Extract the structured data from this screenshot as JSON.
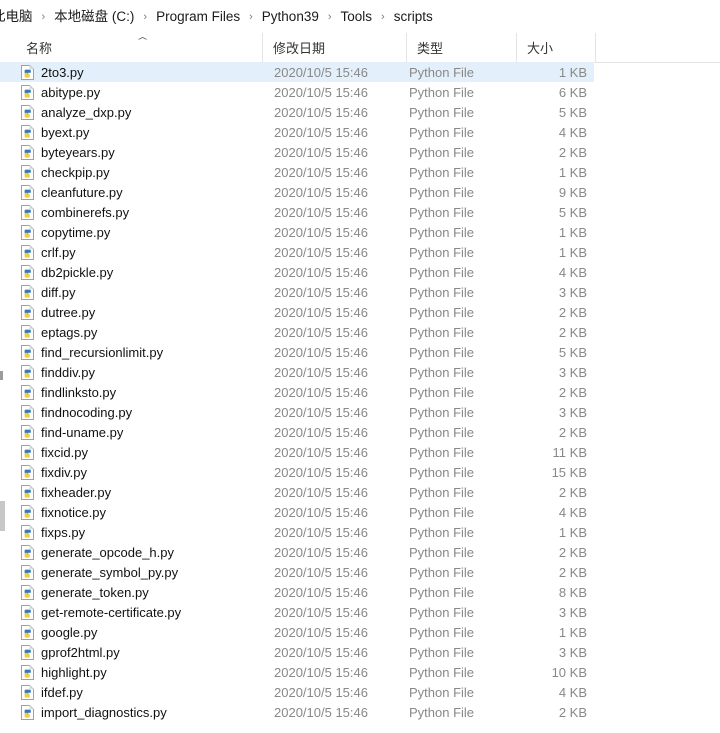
{
  "breadcrumb": {
    "separator": "›",
    "items": [
      {
        "label": "此电脑"
      },
      {
        "label": "本地磁盘 (C:)"
      },
      {
        "label": "Program Files"
      },
      {
        "label": "Python39"
      },
      {
        "label": "Tools"
      },
      {
        "label": "scripts"
      }
    ]
  },
  "columns": {
    "name": "名称",
    "date": "修改日期",
    "type": "类型",
    "size": "大小",
    "sort_caret": "˄"
  },
  "icons": {
    "file": "python-file-icon",
    "sort_ascending": "sort-ascending-icon"
  },
  "colors": {
    "selection": "#e3f0fb",
    "header_text": "#333333",
    "secondary_text": "#888888",
    "divider": "#e4e4e4"
  },
  "files": [
    {
      "name": "2to3.py",
      "date": "2020/10/5 15:46",
      "type": "Python File",
      "size": "1 KB",
      "selected": true
    },
    {
      "name": "abitype.py",
      "date": "2020/10/5 15:46",
      "type": "Python File",
      "size": "6 KB",
      "selected": false
    },
    {
      "name": "analyze_dxp.py",
      "date": "2020/10/5 15:46",
      "type": "Python File",
      "size": "5 KB",
      "selected": false
    },
    {
      "name": "byext.py",
      "date": "2020/10/5 15:46",
      "type": "Python File",
      "size": "4 KB",
      "selected": false
    },
    {
      "name": "byteyears.py",
      "date": "2020/10/5 15:46",
      "type": "Python File",
      "size": "2 KB",
      "selected": false
    },
    {
      "name": "checkpip.py",
      "date": "2020/10/5 15:46",
      "type": "Python File",
      "size": "1 KB",
      "selected": false
    },
    {
      "name": "cleanfuture.py",
      "date": "2020/10/5 15:46",
      "type": "Python File",
      "size": "9 KB",
      "selected": false
    },
    {
      "name": "combinerefs.py",
      "date": "2020/10/5 15:46",
      "type": "Python File",
      "size": "5 KB",
      "selected": false
    },
    {
      "name": "copytime.py",
      "date": "2020/10/5 15:46",
      "type": "Python File",
      "size": "1 KB",
      "selected": false
    },
    {
      "name": "crlf.py",
      "date": "2020/10/5 15:46",
      "type": "Python File",
      "size": "1 KB",
      "selected": false
    },
    {
      "name": "db2pickle.py",
      "date": "2020/10/5 15:46",
      "type": "Python File",
      "size": "4 KB",
      "selected": false
    },
    {
      "name": "diff.py",
      "date": "2020/10/5 15:46",
      "type": "Python File",
      "size": "3 KB",
      "selected": false
    },
    {
      "name": "dutree.py",
      "date": "2020/10/5 15:46",
      "type": "Python File",
      "size": "2 KB",
      "selected": false
    },
    {
      "name": "eptags.py",
      "date": "2020/10/5 15:46",
      "type": "Python File",
      "size": "2 KB",
      "selected": false
    },
    {
      "name": "find_recursionlimit.py",
      "date": "2020/10/5 15:46",
      "type": "Python File",
      "size": "5 KB",
      "selected": false
    },
    {
      "name": "finddiv.py",
      "date": "2020/10/5 15:46",
      "type": "Python File",
      "size": "3 KB",
      "selected": false
    },
    {
      "name": "findlinksto.py",
      "date": "2020/10/5 15:46",
      "type": "Python File",
      "size": "2 KB",
      "selected": false
    },
    {
      "name": "findnocoding.py",
      "date": "2020/10/5 15:46",
      "type": "Python File",
      "size": "3 KB",
      "selected": false
    },
    {
      "name": "find-uname.py",
      "date": "2020/10/5 15:46",
      "type": "Python File",
      "size": "2 KB",
      "selected": false
    },
    {
      "name": "fixcid.py",
      "date": "2020/10/5 15:46",
      "type": "Python File",
      "size": "11 KB",
      "selected": false
    },
    {
      "name": "fixdiv.py",
      "date": "2020/10/5 15:46",
      "type": "Python File",
      "size": "15 KB",
      "selected": false
    },
    {
      "name": "fixheader.py",
      "date": "2020/10/5 15:46",
      "type": "Python File",
      "size": "2 KB",
      "selected": false
    },
    {
      "name": "fixnotice.py",
      "date": "2020/10/5 15:46",
      "type": "Python File",
      "size": "4 KB",
      "selected": false
    },
    {
      "name": "fixps.py",
      "date": "2020/10/5 15:46",
      "type": "Python File",
      "size": "1 KB",
      "selected": false
    },
    {
      "name": "generate_opcode_h.py",
      "date": "2020/10/5 15:46",
      "type": "Python File",
      "size": "2 KB",
      "selected": false
    },
    {
      "name": "generate_symbol_py.py",
      "date": "2020/10/5 15:46",
      "type": "Python File",
      "size": "2 KB",
      "selected": false
    },
    {
      "name": "generate_token.py",
      "date": "2020/10/5 15:46",
      "type": "Python File",
      "size": "8 KB",
      "selected": false
    },
    {
      "name": "get-remote-certificate.py",
      "date": "2020/10/5 15:46",
      "type": "Python File",
      "size": "3 KB",
      "selected": false
    },
    {
      "name": "google.py",
      "date": "2020/10/5 15:46",
      "type": "Python File",
      "size": "1 KB",
      "selected": false
    },
    {
      "name": "gprof2html.py",
      "date": "2020/10/5 15:46",
      "type": "Python File",
      "size": "3 KB",
      "selected": false
    },
    {
      "name": "highlight.py",
      "date": "2020/10/5 15:46",
      "type": "Python File",
      "size": "10 KB",
      "selected": false
    },
    {
      "name": "ifdef.py",
      "date": "2020/10/5 15:46",
      "type": "Python File",
      "size": "4 KB",
      "selected": false
    },
    {
      "name": "import_diagnostics.py",
      "date": "2020/10/5 15:46",
      "type": "Python File",
      "size": "2 KB",
      "selected": false
    }
  ]
}
